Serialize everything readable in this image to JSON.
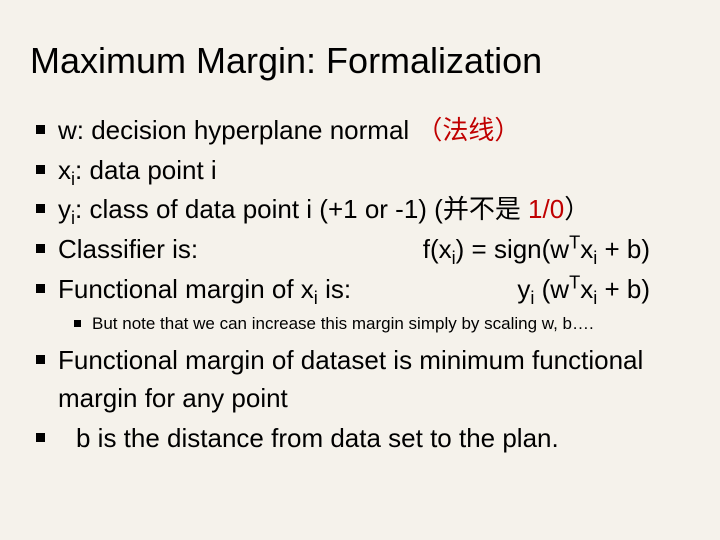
{
  "title": "Maximum Margin: Formalization",
  "b1_a": "w: decision hyperplane normal ",
  "b1_b": "（法线）",
  "b2_a": "x",
  "b2_b": ": data point i",
  "b3_a": "y",
  "b3_b": ": class of data point i (+1 or -1) (并不是 ",
  "b3_c": "1/0",
  "b3_d": "）",
  "b4_left": "Classifier is:",
  "b4_right_a": "f(x",
  "b4_right_b": ") =  sign(w",
  "b4_right_c": "x",
  "b4_right_d": " + b)",
  "b5_left_a": "Functional margin of x",
  "b5_left_b": " is:",
  "b5_right_a": "y",
  "b5_right_b": "(w",
  "b5_right_c": "x",
  "b5_right_d": " + b)",
  "sub1": "But note that we can increase this margin simply by scaling w, b….",
  "b6": "Functional margin of dataset is minimum functional margin for any point",
  "b7": "b is the distance from data set to the plan.",
  "i": "i",
  "T": "T",
  "sp": " "
}
